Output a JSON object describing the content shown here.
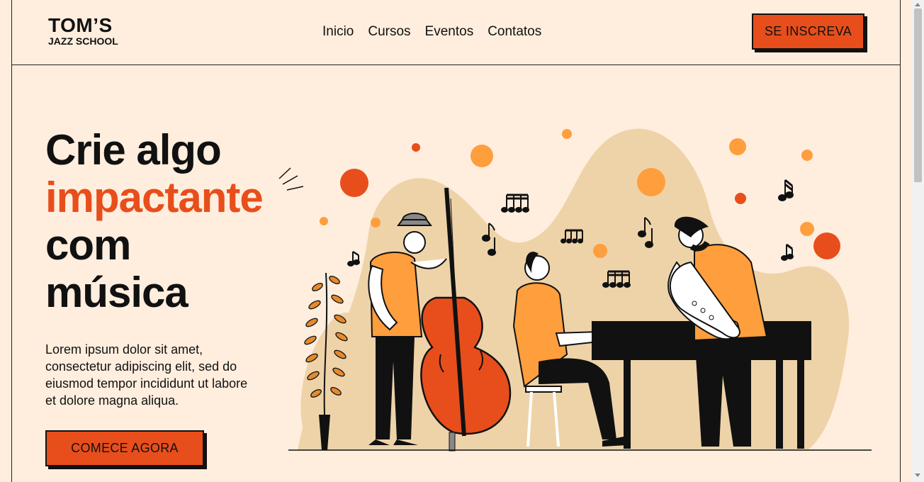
{
  "header": {
    "logo_main": "TOM’S",
    "logo_sub": "JAZZ SCHOOL",
    "nav": [
      "Inicio",
      "Cursos",
      "Eventos",
      "Contatos"
    ],
    "cta": "SE INSCREVA"
  },
  "hero": {
    "title_line1": "Crie algo",
    "title_accent": "impactante",
    "title_line3": "com",
    "title_line4": "música",
    "description": "Lorem ipsum dolor sit amet, consectetur adipiscing elit, sed do eiusmod tempor incididunt ut labore et dolore magna aliqua.",
    "cta": "COMECE AGORA"
  },
  "colors": {
    "background": "#ffeede",
    "accent": "#e84e1b",
    "accent_light": "#ff9e3d",
    "blob": "#eed3a9"
  },
  "illustration": {
    "icons": [
      "jazz-band-illustration",
      "double-bass-icon",
      "piano-icon",
      "saxophone-icon",
      "music-note-icon",
      "plant-icon"
    ]
  }
}
